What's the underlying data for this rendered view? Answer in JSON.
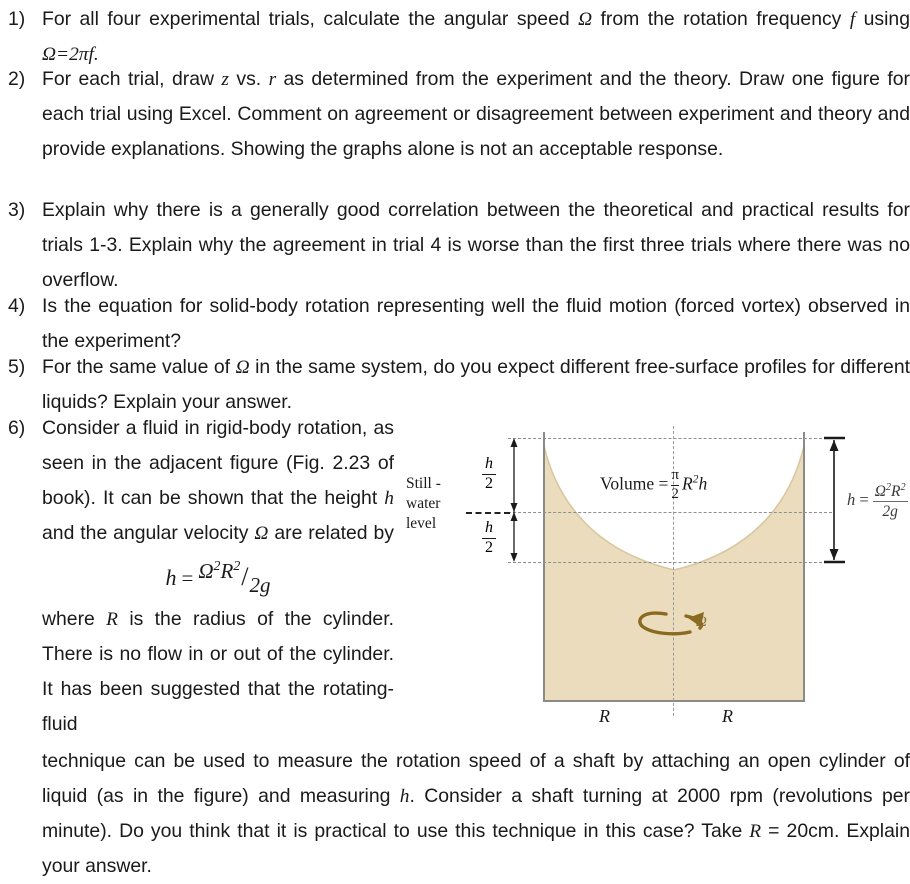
{
  "document": {
    "type": "homework-question-sheet",
    "items": [
      {
        "number": "1)",
        "text_parts": [
          {
            "t": "For all four experimental trials, calculate the angular speed "
          },
          {
            "t": "Ω",
            "style": "italic-symbol"
          },
          {
            "t": " from the rotation frequency "
          },
          {
            "t": "f",
            "style": "italic-symbol"
          },
          {
            "t": " using "
          },
          {
            "t": "Ω=2πf.",
            "style": "italic-symbol"
          }
        ],
        "plain": "For all four experimental trials, calculate the angular speed Ω from the rotation frequency f using Ω=2πf."
      },
      {
        "number": "2)",
        "plain": "For each trial, draw z vs. r as determined from the experiment and the theory. Draw one figure for each trial using Excel. Comment on agreement or disagreement between experiment and theory and provide explanations. Showing the graphs alone is not an acceptable response."
      },
      {
        "number": "3)",
        "plain": "Explain why there is a generally good correlation between the theoretical and practical results for trials 1-3. Explain why the agreement in trial 4 is worse than the first three trials where there was no overflow."
      },
      {
        "number": "4)",
        "plain": "Is the equation for solid-body rotation representing well the fluid motion (forced vortex) observed in the experiment?"
      },
      {
        "number": "5)",
        "plain": "For the same value of Ω in the same system, do you expect different free-surface profiles for different liquids? Explain your answer."
      },
      {
        "number": "6)",
        "column_text": "Consider a fluid in rigid-body rotation, as seen in the adjacent figure (Fig. 2.23 of book). It can be shown that the height h and the angular velocity Ω are related by",
        "equation": {
          "lhs": "h",
          "equals": "=",
          "numerator": "Ω",
          "numerator_sup1": "2",
          "numerator_var": "R",
          "numerator_sup2": "2",
          "slash": "/",
          "denominator": "2g",
          "plain": "h = Ω²R²/2g"
        },
        "column_text_2": "where R is the radius of the cylinder. There is no flow in or out of the cylinder. It has been suggested that the rotating-fluid",
        "tail_text": "technique can be used to measure the rotation speed of a shaft by attaching an open cylinder of liquid (as in the figure) and measuring h. Consider a shaft turning at 2000 rpm (revolutions per minute). Do you think that it is practical to use this technique in this case? Take R = 20cm. Explain your answer."
      }
    ]
  },
  "item1": {
    "number": "1)",
    "line1_a": "For all four experimental trials, calculate the angular speed ",
    "omega": "Ω",
    "line1_b": " from the rotation frequency ",
    "f": "f",
    "line1_c": " using ",
    "formula": "Ω=2πf."
  },
  "item2": {
    "number": "2)",
    "a": "For each trial, draw ",
    "z": "z",
    "b": " vs. ",
    "r": "r",
    "c": " as determined from the experiment and the theory. Draw one figure for each trial using Excel. Comment on agreement or disagreement between experiment and theory and provide explanations. Showing the graphs alone is not an acceptable response."
  },
  "item3": {
    "number": "3)",
    "text": "Explain why there is a generally good correlation between the theoretical and practical results for trials 1-3. Explain why the agreement in trial 4 is worse than the first three trials where there was no overflow."
  },
  "item4": {
    "number": "4)",
    "text": "Is the equation for solid-body rotation representing well the fluid motion (forced vortex) observed in the experiment?"
  },
  "item5": {
    "number": "5)",
    "a": "For the same value of ",
    "omega": "Ω",
    "b": " in the same system, do you expect different free-surface profiles for different liquids? Explain your answer."
  },
  "item6": {
    "number": "6)",
    "p1_a": "Consider a fluid in rigid-body rotation, as seen in the adjacent figure (Fig. 2.23 of book). It can be shown that the height ",
    "h": "h",
    "p1_b": " and the angular velocity ",
    "omega": "Ω",
    "p1_c": " are related by",
    "eq_h": "h",
    "eq_equals": "=",
    "eq_omega": "Ω",
    "eq_sup_a": "2",
    "eq_R": "R",
    "eq_sup_b": "2",
    "eq_slash": "/",
    "eq_den": "2g",
    "p2_a": "where ",
    "R": "R",
    "p2_b": " is the radius of the cylinder. There is no flow in or out of the cylinder. It has been suggested that the rotating-fluid",
    "tail_a": "technique can be used to measure the rotation speed of a shaft by attaching an open cylinder of liquid (as in the figure) and measuring ",
    "tail_h": "h",
    "tail_b": ". Consider a shaft turning at 2000 rpm (revolutions per minute). Do you think that it is practical to use this technique in this case? Take ",
    "tail_R": "R",
    "tail_c": " = 20cm. Explain your answer."
  },
  "figure": {
    "caption_ref": "Fig. 2.23",
    "still_water_label_line1": "Still -",
    "still_water_label_line2": "water",
    "still_water_label_line3": "level",
    "h_half_upper": {
      "num": "h",
      "den": "2"
    },
    "h_half_lower": {
      "num": "h",
      "den": "2"
    },
    "volume_label": "Volume =",
    "volume_frac": {
      "num": "π",
      "den": "2"
    },
    "volume_rest": "R",
    "volume_sup": "2",
    "volume_h": "h",
    "volume_plain": "Volume = (π/2) R²h",
    "h_equation": {
      "lhs": "h",
      "equals": "=",
      "num_omega": "Ω",
      "num_sup1": "2",
      "num_R": "R",
      "num_sup2": "2",
      "den": "2g",
      "plain": "h = Ω²R² / 2g"
    },
    "omega_symbol": "Ω",
    "radius_left_label": "R",
    "radius_right_label": "R",
    "colors": {
      "fluid_fill": "#EBDCBD",
      "fluid_edge": "#C8B894",
      "cylinder_wall": "#8a8a86",
      "dashed_line": "#8f8f8f",
      "rotation_arrow": "#8a6a20",
      "text": "#1a1a1a",
      "page_background": "#ffffff"
    }
  }
}
